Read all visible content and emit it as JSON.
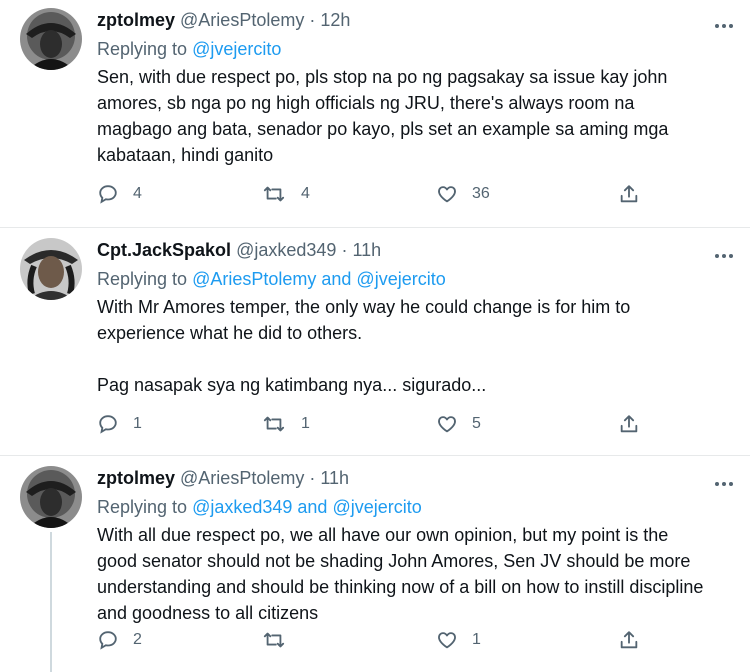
{
  "tweets": [
    {
      "author_name": "zptolmey",
      "author_handle": "@AriesPtolemy",
      "time": "12h",
      "reply_prefix": "Replying to",
      "reply_to": "@jvejercito",
      "text_paragraphs": [
        "Sen, with due respect po, pls stop na po ng pagsakay sa issue kay john amores, sb nga po ng high officials ng JRU, there's always room na magbago ang bata, senador po kayo, pls set an example sa aming mga kabataan, hindi ganito"
      ],
      "replies": "4",
      "retweets": "4",
      "likes": "36"
    },
    {
      "author_name": "Cpt.JackSpakol",
      "author_handle": "@jaxked349",
      "time": "11h",
      "reply_prefix": "Replying to",
      "reply_to": "@AriesPtolemy and @jvejercito",
      "text_paragraphs": [
        "With Mr Amores temper, the only way he could change is for him to experience what he did to others.",
        "Pag nasapak sya ng katimbang nya... sigurado..."
      ],
      "replies": "1",
      "retweets": "1",
      "likes": "5"
    },
    {
      "author_name": "zptolmey",
      "author_handle": "@AriesPtolemy",
      "time": "11h",
      "reply_prefix": "Replying to",
      "reply_to": "@jaxked349 and @jvejercito",
      "text_paragraphs": [
        "With all due respect po, we all have our own opinion, but my point is the good senator should not be shading John Amores, Sen JV should be more understanding and should be thinking now of a bill on how to instill discipline and goodness to all citizens"
      ],
      "replies": "2",
      "retweets": "",
      "likes": "1"
    }
  ],
  "separator": "·",
  "icons": {
    "more": "more-horizontal-icon",
    "reply": "reply-bubble-icon",
    "retweet": "retweet-icon",
    "like": "heart-icon",
    "share": "share-upload-icon"
  },
  "colors": {
    "link": "#1d9bf0",
    "secondary_text": "#536471",
    "primary_text": "#0f1419",
    "divider": "#e7e9ea"
  }
}
